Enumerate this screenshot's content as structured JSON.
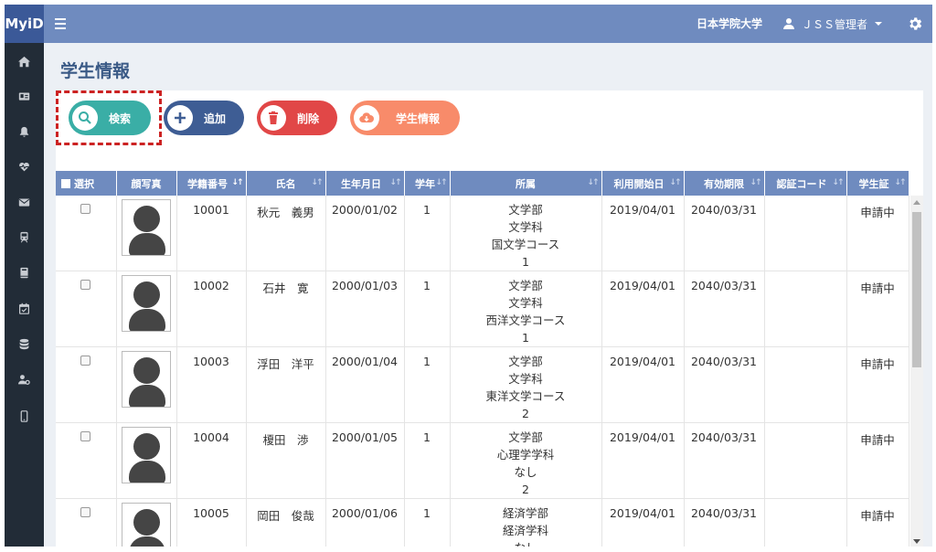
{
  "topbar": {
    "brand": "MyiD",
    "organization": "日本学院大学",
    "user": "ＪＳＳ管理者"
  },
  "page": {
    "title": "学生情報"
  },
  "actions": {
    "search": "検索",
    "add": "追加",
    "delete": "削除",
    "student_info": "学生情報"
  },
  "table": {
    "headers": {
      "select": "選択",
      "photo": "顔写真",
      "student_id": "学籍番号",
      "name": "氏名",
      "birthdate": "生年月日",
      "grade": "学年",
      "affiliation": "所属",
      "start_date": "利用開始日",
      "expiry": "有効期限",
      "auth_code": "認証コード",
      "student_card": "学生証"
    },
    "rows": [
      {
        "id": "10001",
        "name": "秋元　義男",
        "birth": "2000/01/02",
        "grade": "1",
        "aff1": "文学部",
        "aff2": "文学科",
        "aff3": "国文学コース",
        "aff4": "1",
        "start": "2019/04/01",
        "expiry": "2040/03/31",
        "code": "",
        "card": "申請中"
      },
      {
        "id": "10002",
        "name": "石井　寛",
        "birth": "2000/01/03",
        "grade": "1",
        "aff1": "文学部",
        "aff2": "文学科",
        "aff3": "西洋文学コース",
        "aff4": "1",
        "start": "2019/04/01",
        "expiry": "2040/03/31",
        "code": "",
        "card": "申請中"
      },
      {
        "id": "10003",
        "name": "浮田　洋平",
        "birth": "2000/01/04",
        "grade": "1",
        "aff1": "文学部",
        "aff2": "文学科",
        "aff3": "東洋文学コース",
        "aff4": "2",
        "start": "2019/04/01",
        "expiry": "2040/03/31",
        "code": "",
        "card": "申請中"
      },
      {
        "id": "10004",
        "name": "榎田　渉",
        "birth": "2000/01/05",
        "grade": "1",
        "aff1": "文学部",
        "aff2": "心理学学科",
        "aff3": "なし",
        "aff4": "2",
        "start": "2019/04/01",
        "expiry": "2040/03/31",
        "code": "",
        "card": "申請中"
      },
      {
        "id": "10005",
        "name": "岡田　俊哉",
        "birth": "2000/01/06",
        "grade": "1",
        "aff1": "経済学部",
        "aff2": "経済学科",
        "aff3": "なし",
        "aff4": "",
        "start": "2019/04/01",
        "expiry": "2040/03/31",
        "code": "",
        "card": "申請中"
      }
    ]
  },
  "colors": {
    "topbar": "#6f8bbf",
    "brand": "#3b5998",
    "sidebar": "#222c37",
    "search": "#3aaea6",
    "add": "#3e5d94",
    "delete": "#e14747",
    "info": "#f88b6a",
    "highlight": "#cc2222"
  },
  "sidebar": {
    "icons": [
      "home-icon",
      "id-card-icon",
      "bell-icon",
      "heartbeat-icon",
      "envelope-icon",
      "train-icon",
      "book-icon",
      "calendar-check-icon",
      "database-icon",
      "user-settings-icon",
      "mobile-icon"
    ]
  }
}
